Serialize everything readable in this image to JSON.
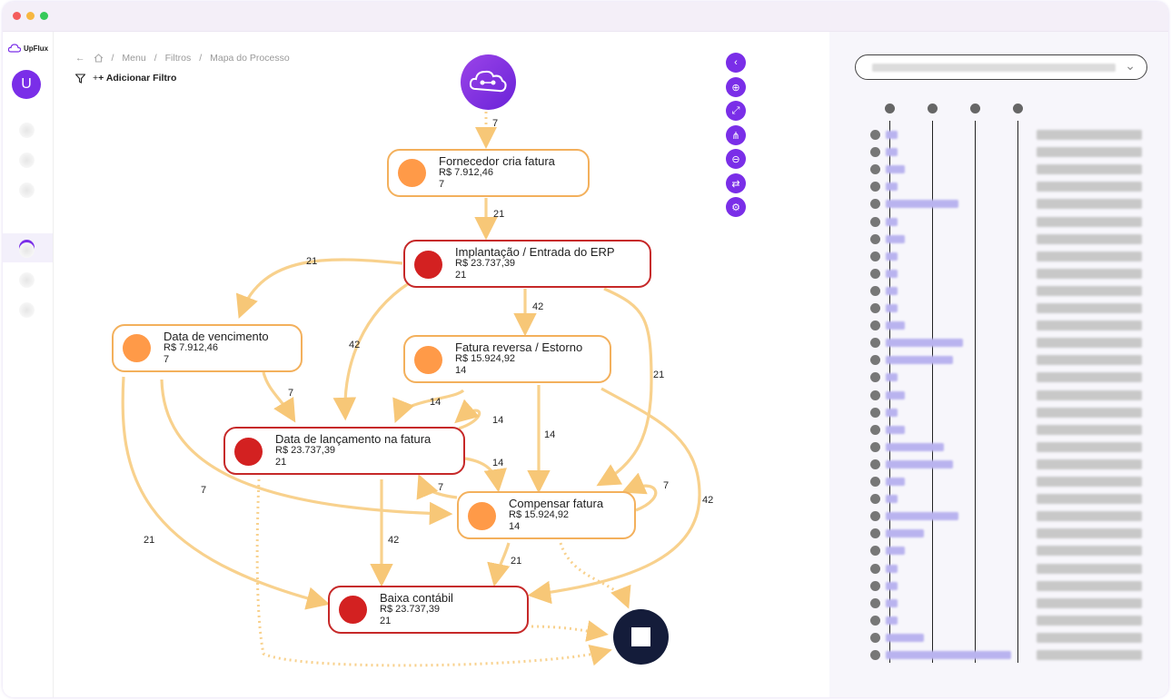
{
  "app": {
    "name": "UpFlux"
  },
  "user": {
    "initial": "U"
  },
  "breadcrumb": {
    "items": [
      "Menu",
      "Filtros",
      "Mapa do Processo"
    ]
  },
  "filter": {
    "add_label": "Adicionar Filtro"
  },
  "toolbar": {
    "icons": [
      "collapse-left-icon",
      "zoom-in-icon",
      "fit-view-icon",
      "hierarchy-icon",
      "zoom-out-icon",
      "swap-icon",
      "settings-icon"
    ]
  },
  "nodes": [
    {
      "name": "Fornecedor cria fatura",
      "value": "R$ 7.912,46",
      "count": "7"
    },
    {
      "name": "Implantação / Entrada do ERP",
      "value": "R$ 23.737,39",
      "count": "21"
    },
    {
      "name": "Data de vencimento",
      "value": "R$ 7.912,46",
      "count": "7"
    },
    {
      "name": "Fatura reversa / Estorno",
      "value": "R$ 15.924,92",
      "count": "14"
    },
    {
      "name": "Data de lançamento na fatura",
      "value": "R$ 23.737,39",
      "count": "21"
    },
    {
      "name": "Compensar fatura",
      "value": "R$ 15.924,92",
      "count": "14"
    },
    {
      "name": "Baixa contábil",
      "value": "R$ 23.737,39",
      "count": "21"
    }
  ],
  "edge_labels": [
    "7",
    "21",
    "21",
    "42",
    "42",
    "21",
    "7",
    "14",
    "14",
    "14",
    "14",
    "7",
    "7",
    "42",
    "21",
    "21",
    "42"
  ],
  "right_panel": {
    "bars": [
      0.08,
      0.08,
      0.13,
      0.08,
      0.5,
      0.08,
      0.13,
      0.08,
      0.08,
      0.08,
      0.08,
      0.13,
      0.53,
      0.46,
      0.08,
      0.13,
      0.08,
      0.13,
      0.4,
      0.46,
      0.13,
      0.08,
      0.5,
      0.26,
      0.13,
      0.08,
      0.08,
      0.08,
      0.08,
      0.26,
      0.86
    ]
  },
  "colors": {
    "accent": "#7a2ee8",
    "activity_orange": "#ff9a48",
    "activity_red": "#d32121",
    "edge": "#f8d18d",
    "end": "#141c3a"
  }
}
